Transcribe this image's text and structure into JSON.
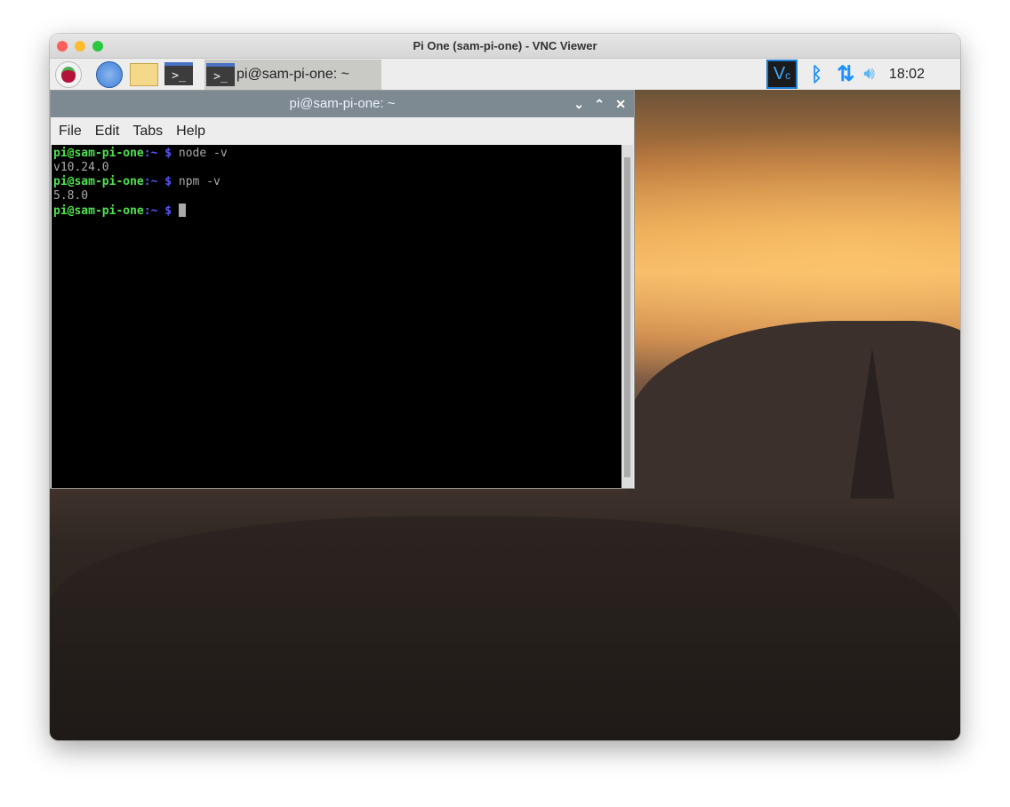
{
  "window": {
    "title": "Pi One (sam-pi-one) - VNC Viewer"
  },
  "taskbar": {
    "launchers": [
      "raspberry-menu",
      "web-browser",
      "file-manager",
      "terminal"
    ],
    "task_label": "pi@sam-pi-one: ~",
    "clock": "18:02"
  },
  "terminal": {
    "title": "pi@sam-pi-one: ~",
    "menu": [
      "File",
      "Edit",
      "Tabs",
      "Help"
    ],
    "lines": [
      {
        "prompt": "pi@sam-pi-one",
        "path": ":~",
        "dollar": "$",
        "cmd": " node -v"
      },
      {
        "output": "v10.24.0"
      },
      {
        "prompt": "pi@sam-pi-one",
        "path": ":~",
        "dollar": "$",
        "cmd": " npm -v"
      },
      {
        "output": "5.8.0"
      },
      {
        "prompt": "pi@sam-pi-one",
        "path": ":~",
        "dollar": "$",
        "cmd": " "
      }
    ]
  },
  "colors": {
    "prompt": "#4fe34f",
    "dollar": "#5757ff",
    "accent": "#1e90ff"
  }
}
